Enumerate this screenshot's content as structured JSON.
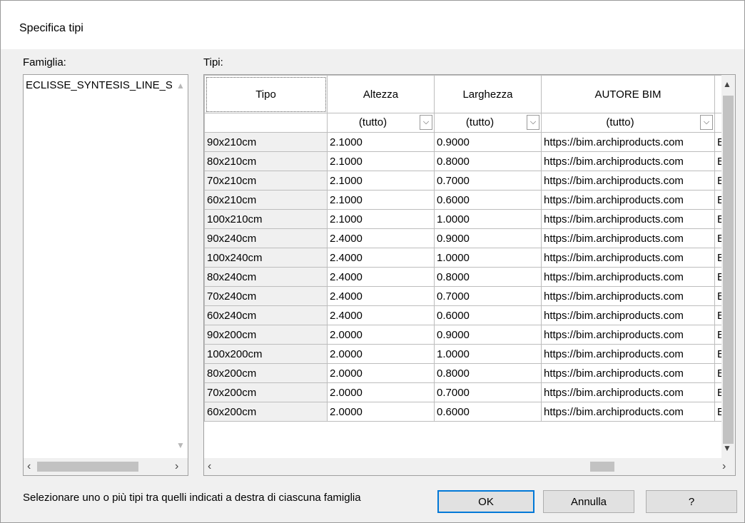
{
  "window": {
    "title": "Specifica tipi"
  },
  "family": {
    "label": "Famiglia:",
    "items": [
      "ECLISSE_SYNTESIS_LINE_SC"
    ]
  },
  "types": {
    "label": "Tipi:",
    "columns": [
      "Tipo",
      "Altezza",
      "Larghezza",
      "AUTORE BIM"
    ],
    "filters": [
      "(tutto)",
      "(tutto)",
      "(tutto)"
    ],
    "rows": [
      [
        "90x210cm",
        "2.1000",
        "0.9000",
        "https://bim.archiproducts.com",
        "E"
      ],
      [
        "80x210cm",
        "2.1000",
        "0.8000",
        "https://bim.archiproducts.com",
        "E"
      ],
      [
        "70x210cm",
        "2.1000",
        "0.7000",
        "https://bim.archiproducts.com",
        "E"
      ],
      [
        "60x210cm",
        "2.1000",
        "0.6000",
        "https://bim.archiproducts.com",
        "E"
      ],
      [
        "100x210cm",
        "2.1000",
        "1.0000",
        "https://bim.archiproducts.com",
        "E"
      ],
      [
        "90x240cm",
        "2.4000",
        "0.9000",
        "https://bim.archiproducts.com",
        "E"
      ],
      [
        "100x240cm",
        "2.4000",
        "1.0000",
        "https://bim.archiproducts.com",
        "E"
      ],
      [
        "80x240cm",
        "2.4000",
        "0.8000",
        "https://bim.archiproducts.com",
        "E"
      ],
      [
        "70x240cm",
        "2.4000",
        "0.7000",
        "https://bim.archiproducts.com",
        "E"
      ],
      [
        "60x240cm",
        "2.4000",
        "0.6000",
        "https://bim.archiproducts.com",
        "E"
      ],
      [
        "90x200cm",
        "2.0000",
        "0.9000",
        "https://bim.archiproducts.com",
        "E"
      ],
      [
        "100x200cm",
        "2.0000",
        "1.0000",
        "https://bim.archiproducts.com",
        "E"
      ],
      [
        "80x200cm",
        "2.0000",
        "0.8000",
        "https://bim.archiproducts.com",
        "E"
      ],
      [
        "70x200cm",
        "2.0000",
        "0.7000",
        "https://bim.archiproducts.com",
        "E"
      ],
      [
        "60x200cm",
        "2.0000",
        "0.6000",
        "https://bim.archiproducts.com",
        "E"
      ]
    ]
  },
  "status": "Selezionare uno o più tipi tra quelli indicati a destra di ciascuna famiglia",
  "buttons": {
    "ok": "OK",
    "cancel": "Annulla",
    "help": "?"
  },
  "icons": {
    "scroll_up": "up-arrow-icon",
    "scroll_down": "down-arrow-icon",
    "scroll_left": "left-arrow-icon",
    "scroll_right": "right-arrow-icon",
    "dropdown": "chevron-down-icon"
  },
  "colors": {
    "accent": "#0078d7",
    "panel": "#f0f0f0",
    "grid_line": "#bdbdbd"
  }
}
